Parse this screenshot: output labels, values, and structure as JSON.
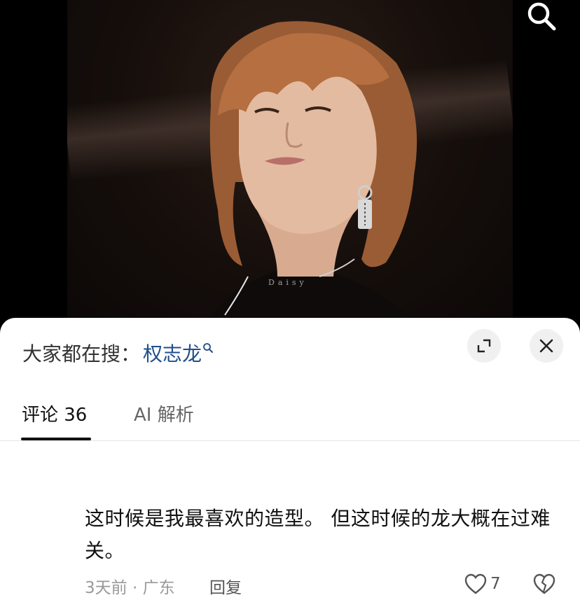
{
  "header": {
    "search_icon": "search-icon"
  },
  "photo": {
    "watermark": "Daisy"
  },
  "sheet": {
    "search_hint": {
      "label": "大家都在搜：",
      "keyword": "权志龙"
    },
    "expand_icon": "expand-icon",
    "close_icon": "close-icon"
  },
  "tabs": [
    {
      "label": "评论 36",
      "active": true
    },
    {
      "label": "AI 解析",
      "active": false
    }
  ],
  "comment": {
    "text": "这时候是我最喜欢的造型。 但这时候的龙大概在过难关。",
    "time_location": "3天前 · 广东",
    "reply_label": "回复",
    "like_count": "7"
  },
  "colors": {
    "keyword_link": "#1f4e8c",
    "sheet_background": "#ffffff",
    "page_background": "#000000"
  }
}
